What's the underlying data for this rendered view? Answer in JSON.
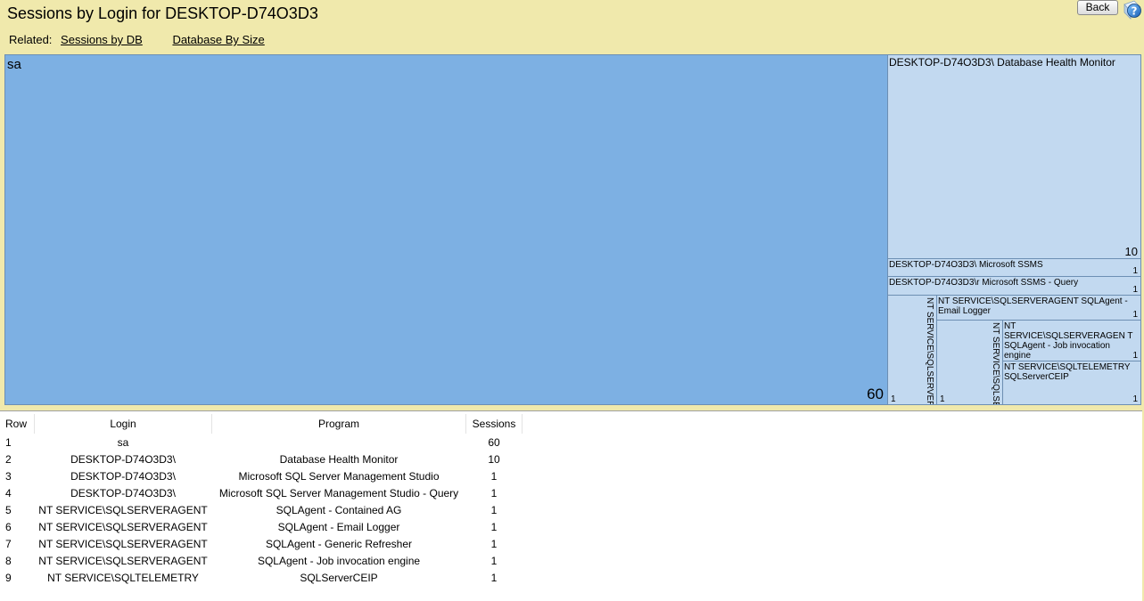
{
  "header": {
    "title": "Sessions by Login for DESKTOP-D74O3D3",
    "back_label": "Back"
  },
  "related": {
    "label": "Related:",
    "links": [
      "Sessions by DB",
      "Database By Size"
    ]
  },
  "chart_data": {
    "type": "treemap",
    "nodes": [
      {
        "row": 1,
        "login": "sa",
        "program": "",
        "value": 60
      },
      {
        "row": 2,
        "login": "DESKTOP-D74O3D3\\",
        "program": "Database Health Monitor",
        "value": 10
      },
      {
        "row": 3,
        "login": "DESKTOP-D74O3D3\\",
        "program": "Microsoft SSMS",
        "value": 1
      },
      {
        "row": 4,
        "login": "DESKTOP-D74O3D3\\r",
        "program": "Microsoft SSMS - Query",
        "value": 1
      },
      {
        "row": 5,
        "login": "NT SERVICE\\SQLSERVER AGENT",
        "program": "SQLAgent - Contained AG",
        "value": 1
      },
      {
        "row": 6,
        "login": "NT SERVICE\\SQLSERVERAGENT",
        "program": "SQLAgent - Email Logger",
        "value": 1
      },
      {
        "row": 7,
        "login": "NT SERVICE\\SQLSE RVERAGENT",
        "program": "SQLAgent - Generic Refresher",
        "value": 1
      },
      {
        "row": 8,
        "login": "NT SERVICE\\SQLSERVERAGEN T",
        "program": "SQLAgent - Job invocation engine",
        "value": 1
      },
      {
        "row": 9,
        "login": "NT SERVICE\\SQLTELEMETRY",
        "program": "SQLServerCEIP",
        "value": 1
      }
    ],
    "tiles": [
      {
        "text": "sa",
        "value": 60,
        "big": true
      },
      {
        "text": "DESKTOP-D74O3D3\\          Database Health Monitor",
        "value": 10
      },
      {
        "text": "DESKTOP-D74O3D3\\          Microsoft SSMS",
        "value": 1
      },
      {
        "text": "DESKTOP-D74O3D3\\r          Microsoft SSMS - Query",
        "value": 1
      },
      {
        "text": "NT SERVICE\\SQLSERVER AGENT SQLAgent - Contained AG",
        "value": 1,
        "vertical": true
      },
      {
        "text": "NT SERVICE\\SQLSERVERAGENT SQLAgent - Email Logger",
        "value": 1
      },
      {
        "text": "NT SERVICE\\SQLSE RVERAGENT SQLAgent - Generic Refresher",
        "value": 1,
        "vertical": true
      },
      {
        "text": "NT SERVICE\\SQLSERVERAGEN T SQLAgent - Job invocation engine",
        "value": 1
      },
      {
        "text": "NT SERVICE\\SQLTELEMETRY SQLServerCEIP",
        "value": 1
      }
    ]
  },
  "table": {
    "columns": [
      "Row",
      "Login",
      "Program",
      "Sessions"
    ],
    "rows": [
      [
        "1",
        "sa",
        "",
        "60"
      ],
      [
        "2",
        "DESKTOP-D74O3D3\\",
        "Database Health Monitor",
        "10"
      ],
      [
        "3",
        "DESKTOP-D74O3D3\\",
        "Microsoft SQL Server Management Studio",
        "1"
      ],
      [
        "4",
        "DESKTOP-D74O3D3\\",
        "Microsoft SQL Server Management Studio - Query",
        "1"
      ],
      [
        "5",
        "NT SERVICE\\SQLSERVERAGENT",
        "SQLAgent - Contained AG",
        "1"
      ],
      [
        "6",
        "NT SERVICE\\SQLSERVERAGENT",
        "SQLAgent - Email Logger",
        "1"
      ],
      [
        "7",
        "NT SERVICE\\SQLSERVERAGENT",
        "SQLAgent - Generic Refresher",
        "1"
      ],
      [
        "8",
        "NT SERVICE\\SQLSERVERAGENT",
        "SQLAgent - Job invocation engine",
        "1"
      ],
      [
        "9",
        "NT SERVICE\\SQLTELEMETRY",
        "SQLServerCEIP",
        "1"
      ]
    ]
  },
  "icons": {
    "help": "help-icon"
  },
  "colors": {
    "background": "#f0e9ac",
    "tile_large": "#7db0e3",
    "tile_small": "#c2d9f0",
    "tile_border": "#6d8fb3"
  }
}
